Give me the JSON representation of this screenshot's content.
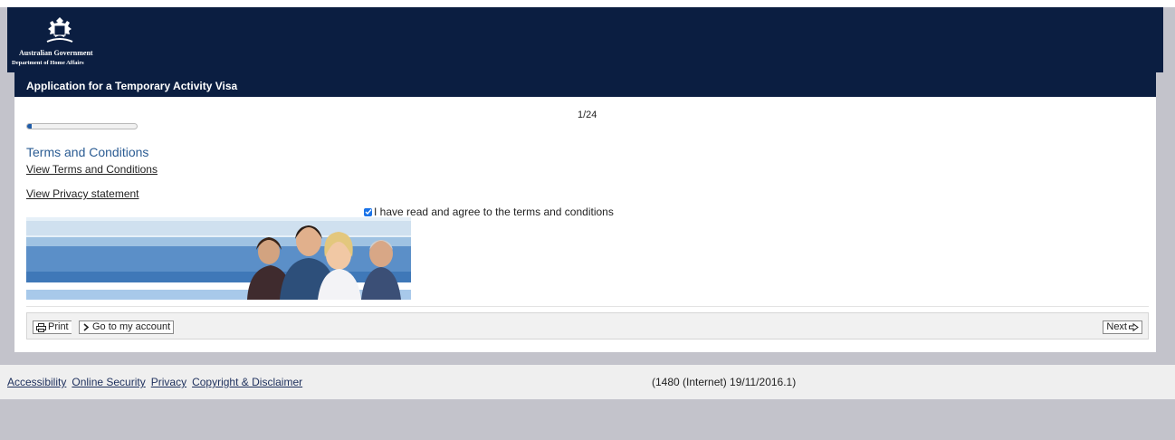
{
  "header": {
    "gov_name": "Australian Government",
    "dept_name": "Department of Home Affairs",
    "emblem_icon": "coat-of-arms-icon"
  },
  "title": "Application for a Temporary Activity Visa",
  "progress": {
    "label": "1/24",
    "fraction": 0.04,
    "color": "#1f5ca8"
  },
  "section": {
    "heading": "Terms and Conditions",
    "terms_link": "View Terms and Conditions",
    "privacy_link": "View Privacy statement",
    "agree_label": "I have read and agree to the terms and conditions",
    "agree_checked": true
  },
  "toolbar": {
    "print_label": "Print",
    "account_label": "Go to my account",
    "next_label": "Next",
    "print_icon": "printer-icon",
    "account_icon": "chevron-right-icon",
    "next_icon": "arrow-right-icon"
  },
  "footer": {
    "links": [
      "Accessibility",
      "Online Security",
      "Privacy",
      "Copyright & Disclaimer"
    ],
    "version": "(1480 (Internet) 19/11/2016.1)"
  },
  "colors": {
    "header_bg": "#0b1e41",
    "heading": "#2b5c93",
    "page_bg": "#c3c3cb"
  }
}
